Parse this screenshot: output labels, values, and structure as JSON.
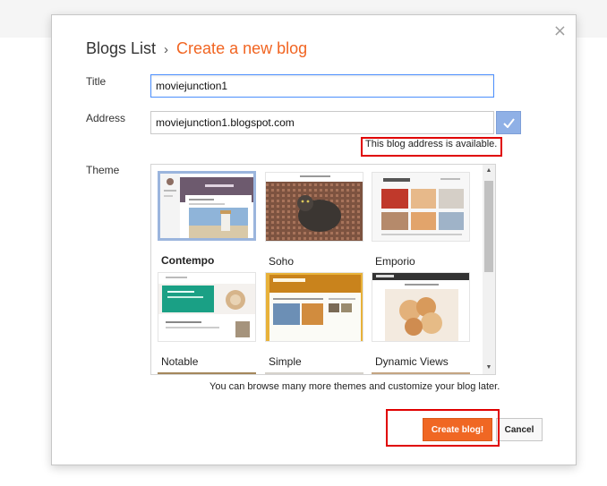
{
  "dialog": {
    "close_label": "×",
    "breadcrumb": {
      "home": "Blogs List",
      "separator": "›",
      "current": "Create a new blog"
    }
  },
  "form": {
    "title_label": "Title",
    "title_value": "moviejunction1",
    "address_label": "Address",
    "address_value": "moviejunction1.blogspot.com",
    "availability_message": "This blog address is available.",
    "theme_label": "Theme",
    "hint": "You can browse many more themes and customize your blog later."
  },
  "themes": [
    {
      "name": "Contempo",
      "selected": true
    },
    {
      "name": "Soho",
      "selected": false
    },
    {
      "name": "Emporio",
      "selected": false
    },
    {
      "name": "Notable",
      "selected": false
    },
    {
      "name": "Simple",
      "selected": false
    },
    {
      "name": "Dynamic Views",
      "selected": false
    }
  ],
  "buttons": {
    "create": "Create blog!",
    "cancel": "Cancel"
  },
  "colors": {
    "accent": "#f16522",
    "highlight": "#e00000",
    "focus": "#4d90fe"
  },
  "icons": {
    "close": "close-icon",
    "check": "check-icon"
  }
}
